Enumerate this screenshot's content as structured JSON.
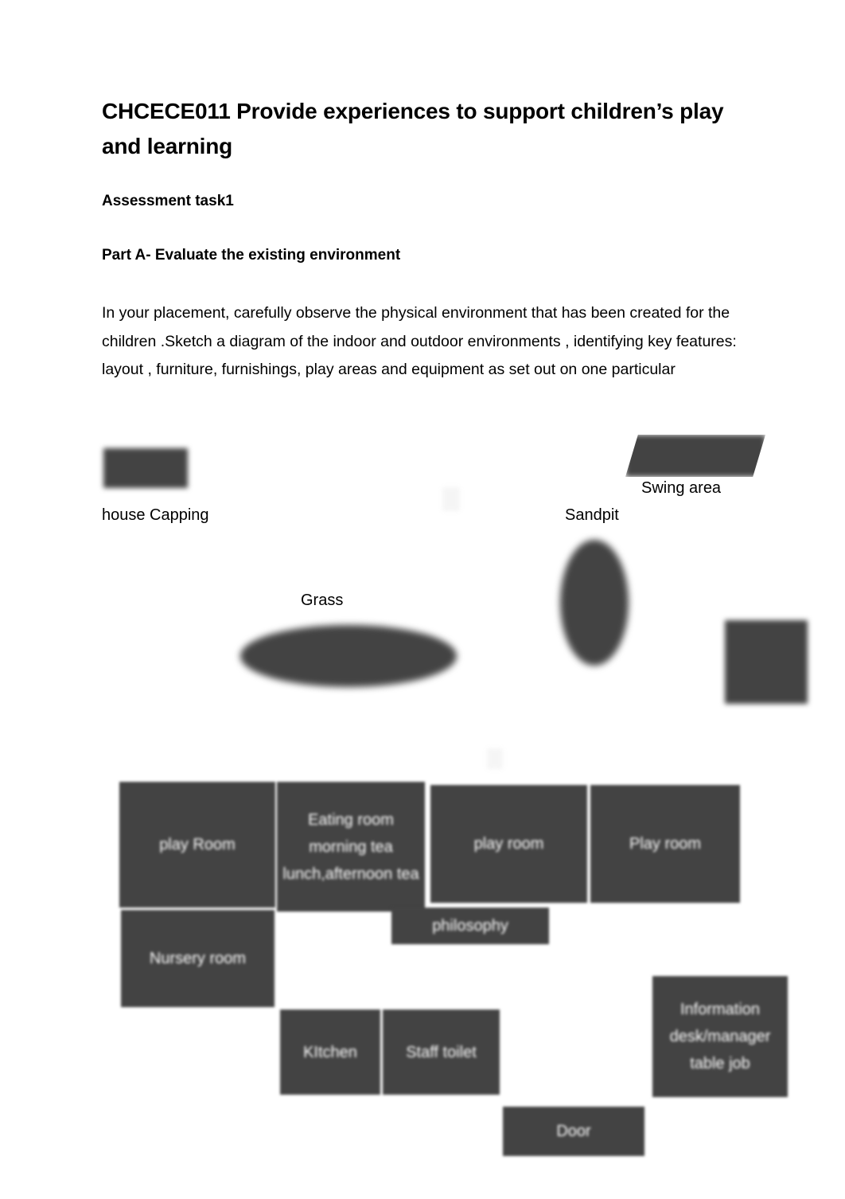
{
  "document": {
    "title": "CHCECE011 Provide experiences to support children’s play and learning",
    "assessment_heading": "Assessment task1",
    "part_heading": "Part A- Evaluate the existing environment",
    "paragraph": "In your placement, carefully observe the physical environment that has been created for the children .Sketch a diagram of the indoor and outdoor environments , identifying key features: layout , furniture, furnishings, play areas and equipment as set out on one particular"
  },
  "diagram": {
    "outdoor_labels": [
      {
        "text": "house Capping"
      },
      {
        "text": "Sandpit"
      },
      {
        "text": "Swing area"
      },
      {
        "text": "Grass"
      }
    ],
    "rooms": [
      {
        "label": "play Room"
      },
      {
        "label": "Eating room morning tea lunch,afternoon tea"
      },
      {
        "label": "play room"
      },
      {
        "label": "Play room"
      },
      {
        "label": "philosophy"
      },
      {
        "label": "Nursery room"
      },
      {
        "label": "KItchen"
      },
      {
        "label": "Staff toilet"
      },
      {
        "label": "Information desk/manager table job"
      },
      {
        "label": "Door"
      }
    ],
    "colors": {
      "shape_fill": "#434343",
      "room_fill": "#434343",
      "room_text": "#ffffff",
      "page_background": "#ffffff"
    }
  }
}
